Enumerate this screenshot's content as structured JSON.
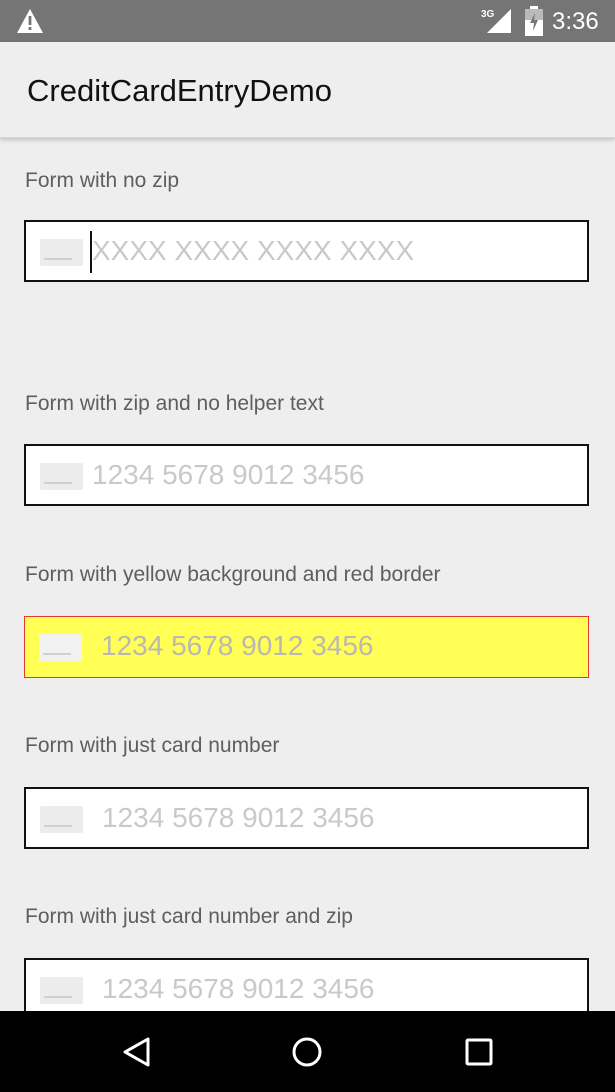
{
  "status_bar": {
    "time": "3:36",
    "network": "3G",
    "icons": [
      "warning-icon",
      "signal-3g-icon",
      "battery-icon"
    ]
  },
  "app_bar": {
    "title": "CreditCardEntryDemo"
  },
  "forms": [
    {
      "label": "Form with no zip",
      "placeholder": "XXXX XXXX XXXX XXXX",
      "style": "default",
      "focused": true
    },
    {
      "label": "Form with zip and no helper text",
      "placeholder": "1234 5678 9012 3456",
      "style": "default",
      "focused": false
    },
    {
      "label": "Form with yellow background and red border",
      "placeholder": "1234 5678 9012 3456",
      "style": "yellow-red",
      "focused": false
    },
    {
      "label": "Form with just card number",
      "placeholder": "1234 5678 9012 3456",
      "style": "default",
      "focused": false
    },
    {
      "label": "Form with just card number and zip",
      "placeholder": "1234 5678 9012 3456",
      "style": "default",
      "focused": false
    }
  ],
  "colors": {
    "background": "#eeeeee",
    "status_bar": "#757575",
    "yellow_field": "#ffff55",
    "red_border": "#e23b2e",
    "placeholder": "#c9c9c9"
  },
  "nav_bar": {
    "icons": [
      "back-icon",
      "home-icon",
      "recents-icon"
    ]
  }
}
